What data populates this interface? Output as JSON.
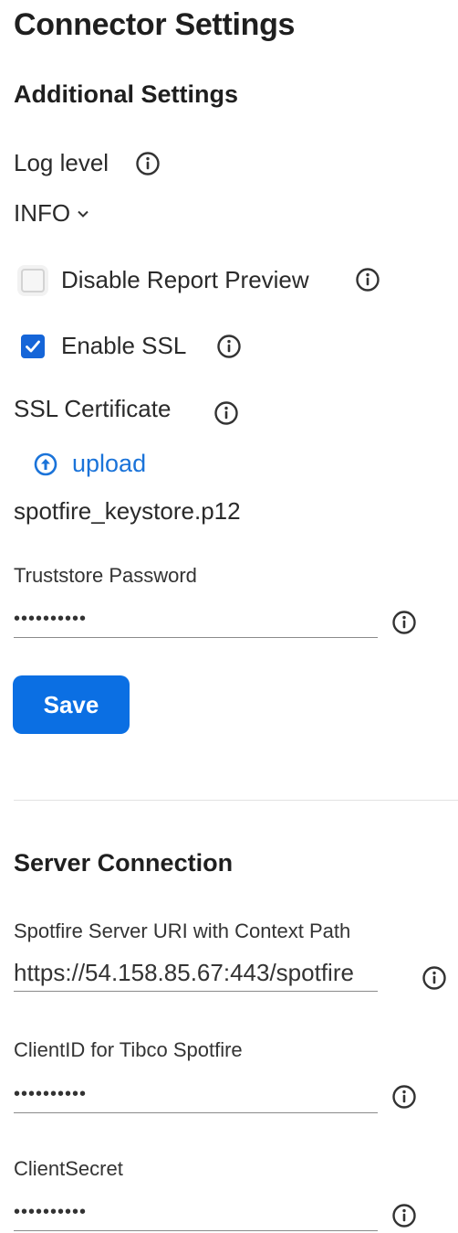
{
  "page": {
    "title": "Connector Settings"
  },
  "additional_settings": {
    "heading": "Additional Settings",
    "log_level": {
      "label": "Log level",
      "value": "INFO"
    },
    "disable_report_preview": {
      "label": "Disable Report Preview",
      "checked": false
    },
    "enable_ssl": {
      "label": "Enable SSL",
      "checked": true
    },
    "ssl_certificate": {
      "label": "SSL Certificate",
      "upload_label": "upload",
      "file_name": "spotfire_keystore.p12"
    },
    "truststore_password": {
      "label": "Truststore Password",
      "value": "••••••••••"
    },
    "save_label": "Save"
  },
  "server_connection": {
    "heading": "Server Connection",
    "server_uri": {
      "label": "Spotfire Server URI with Context Path",
      "value": "https://54.158.85.67:443/spotfire"
    },
    "client_id": {
      "label": "ClientID for Tibco Spotfire",
      "value": "••••••••••"
    },
    "client_secret": {
      "label": "ClientSecret",
      "value": "••••••••••"
    }
  },
  "colors": {
    "accent": "#0b6fe3",
    "link": "#1a73d9",
    "checkbox_checked": "#1565d8"
  },
  "icons": [
    "info-icon",
    "chevron-down-icon",
    "checkmark-icon",
    "upload-arrow-icon"
  ]
}
